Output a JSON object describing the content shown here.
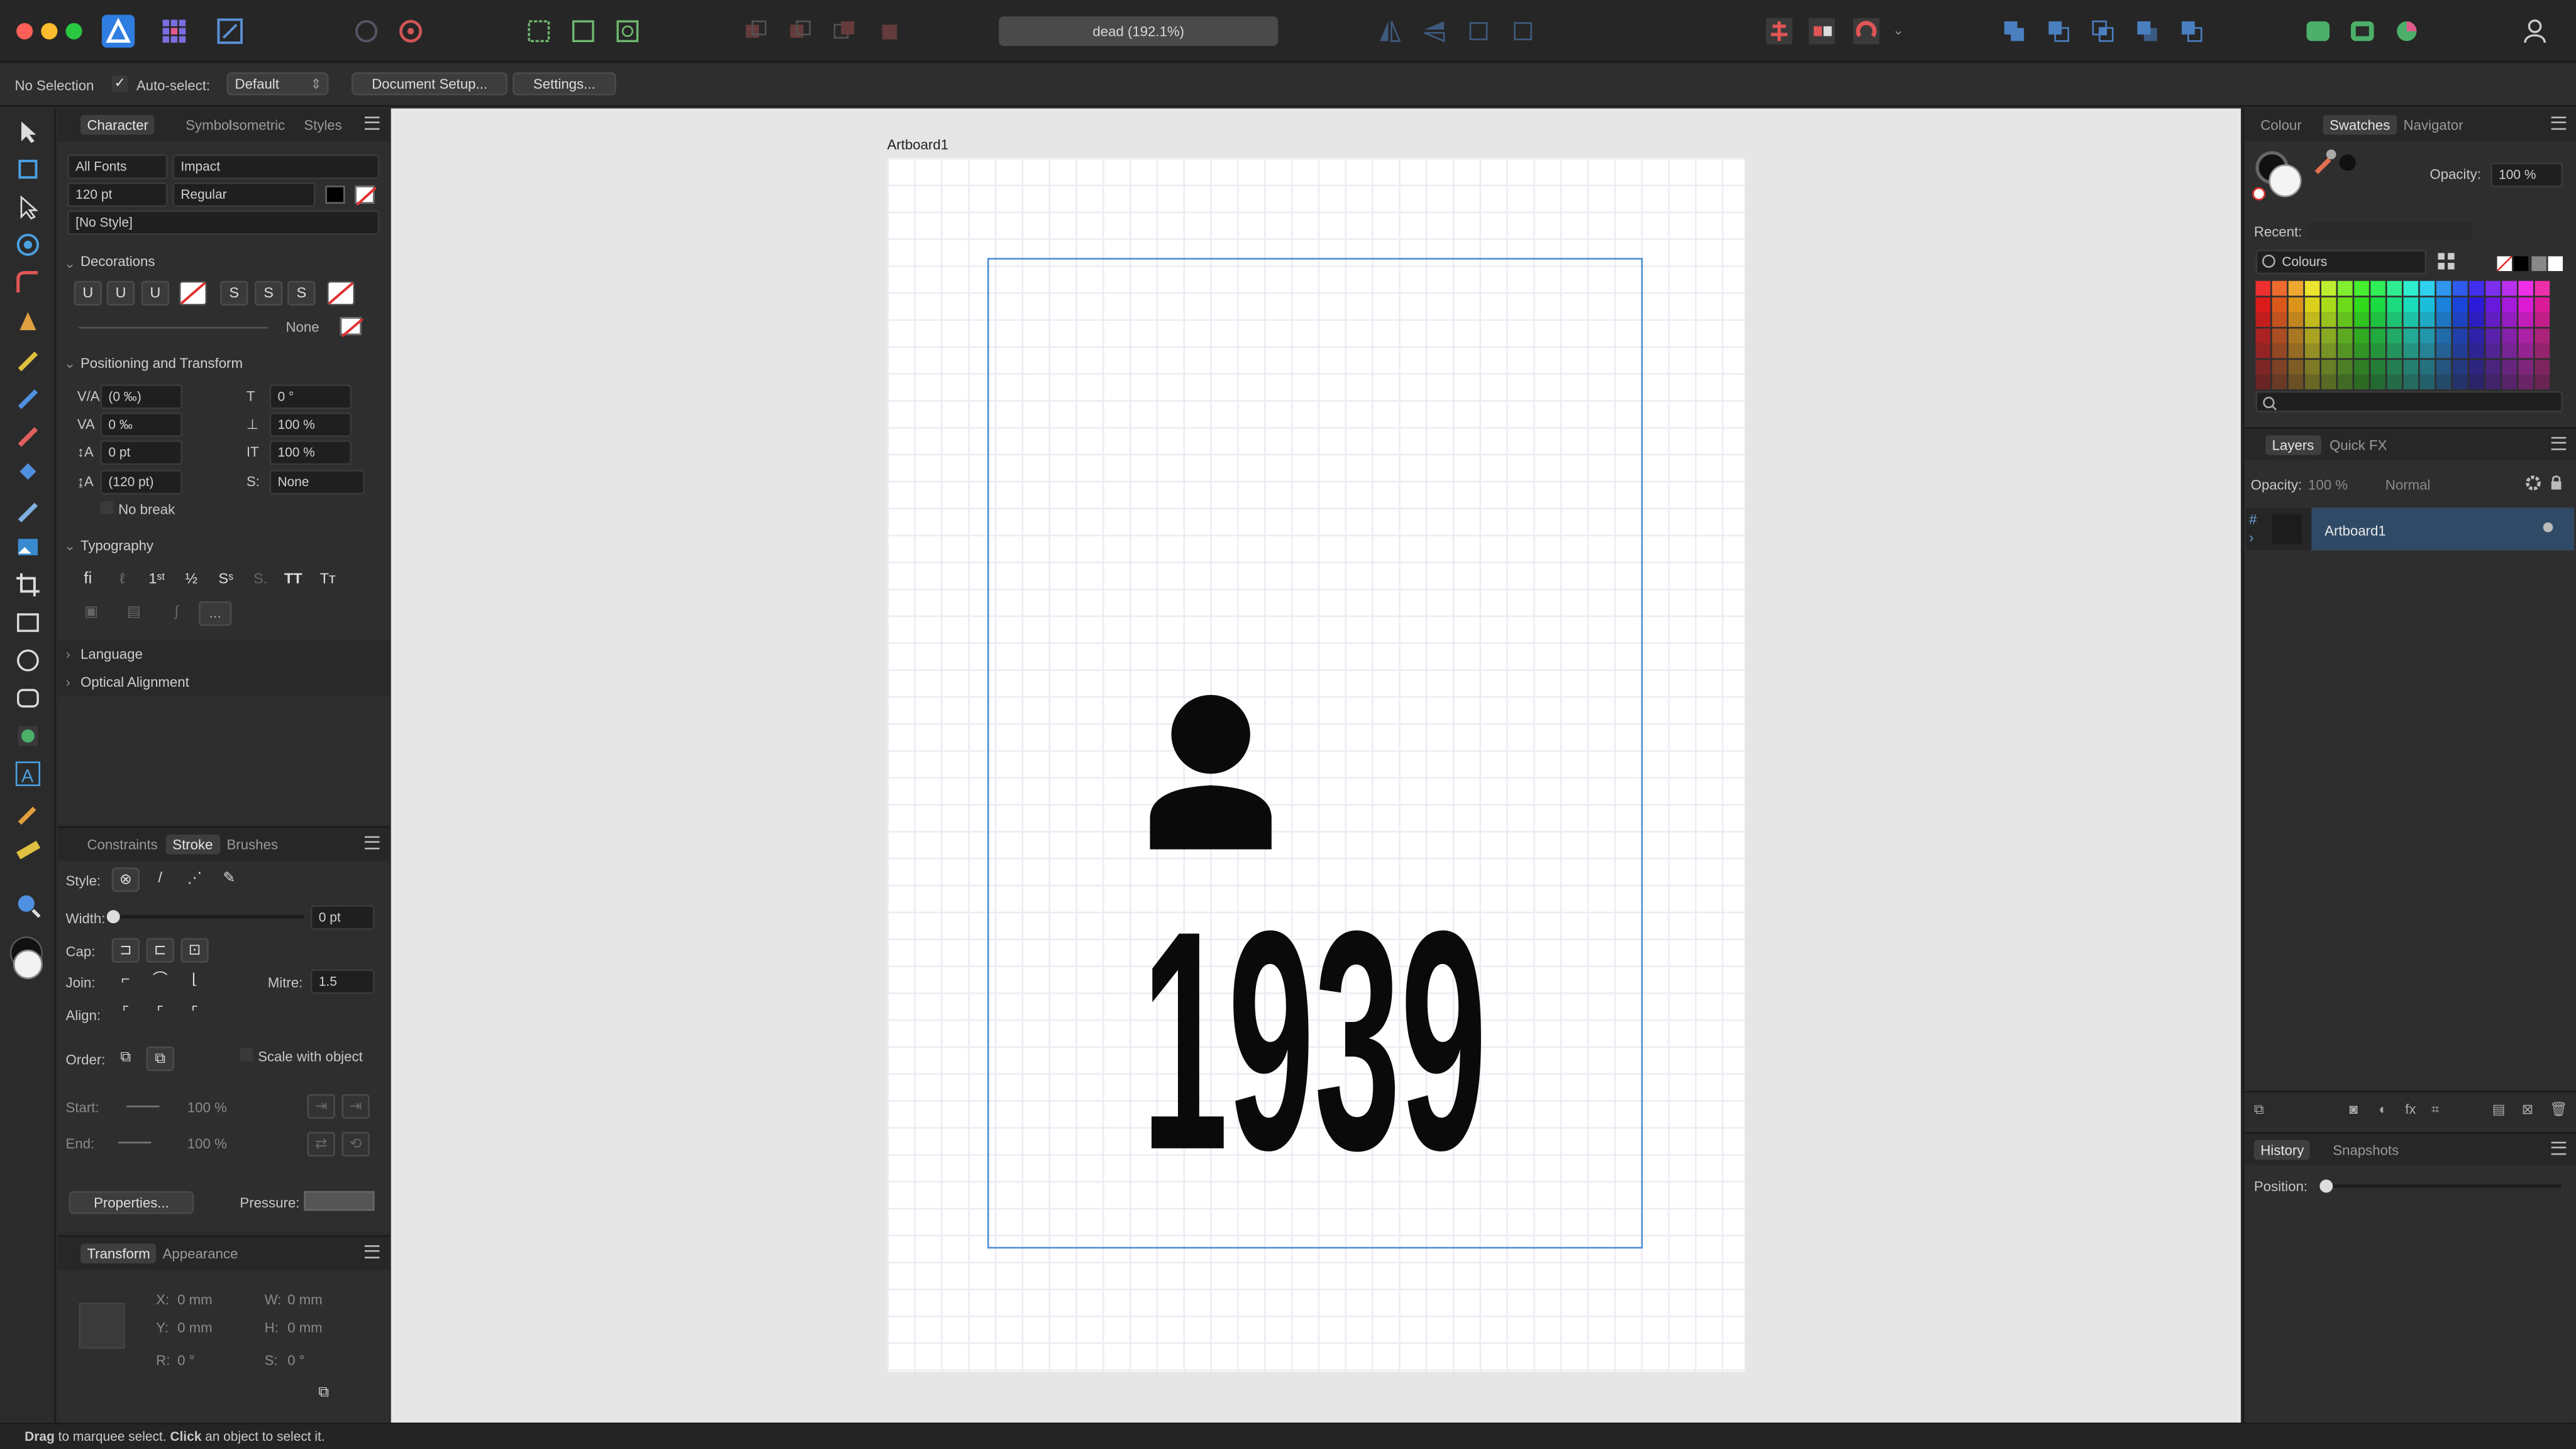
{
  "app": {
    "doc_title": "dead (192.1%)"
  },
  "context_bar": {
    "selection": "No Selection",
    "auto_select_label": "Auto-select:",
    "auto_select_value": "Default",
    "document_setup": "Document Setup...",
    "settings": "Settings..."
  },
  "character_panel": {
    "tabs": [
      "Character",
      "Symbols",
      "Isometric",
      "Styles"
    ],
    "font_collection": "All Fonts",
    "font_family": "Impact",
    "font_size": "120 pt",
    "font_style": "Regular",
    "paragraph_style": "[No Style]",
    "decorations_header": "Decorations",
    "decorations_none": "None",
    "positioning_header": "Positioning and Transform",
    "kerning": "(0 ‰)",
    "tracking": "0 ‰",
    "baseline": "0 pt",
    "leading": "(120 pt)",
    "shear": "0 °",
    "vertical_scale": "100 %",
    "horizontal_scale": "100 %",
    "caps": "None",
    "no_break": "No break",
    "typography_header": "Typography",
    "typo_ellipsis": "...",
    "language_header": "Language",
    "optical_header": "Optical Alignment"
  },
  "stroke_panel": {
    "tabs": [
      "Constraints",
      "Stroke",
      "Brushes"
    ],
    "style_label": "Style:",
    "width_label": "Width:",
    "width_value": "0 pt",
    "cap_label": "Cap:",
    "join_label": "Join:",
    "mitre_label": "Mitre:",
    "mitre_value": "1.5",
    "align_label": "Align:",
    "order_label": "Order:",
    "scale_with_object": "Scale with object",
    "start_label": "Start:",
    "start_pct": "100 %",
    "end_label": "End:",
    "end_pct": "100 %",
    "properties_button": "Properties...",
    "pressure_label": "Pressure:"
  },
  "transform_panel": {
    "tabs": [
      "Transform",
      "Appearance"
    ],
    "x_label": "X:",
    "x_value": "0 mm",
    "y_label": "Y:",
    "y_value": "0 mm",
    "w_label": "W:",
    "w_value": "0 mm",
    "h_label": "H:",
    "h_value": "0 mm",
    "r_label": "R:",
    "r_value": "0 °",
    "s_label": "S:",
    "s_value": "0 °"
  },
  "canvas": {
    "artboard_label": "Artboard1",
    "artwork_text": "1939"
  },
  "swatches_panel": {
    "tabs": [
      "Colour",
      "Swatches",
      "Navigator"
    ],
    "opacity_label": "Opacity:",
    "opacity_value": "100 %",
    "recent_label": "Recent:",
    "palette": "Colours"
  },
  "layers_panel": {
    "tabs": [
      "Layers",
      "Quick FX"
    ],
    "opacity_label": "Opacity:",
    "opacity_value": "100 %",
    "blend_mode": "Normal",
    "layer_name": "Artboard1"
  },
  "history_panel": {
    "tabs": [
      "History",
      "Snapshots"
    ],
    "position_label": "Position:"
  },
  "status": {
    "drag_bold": "Drag",
    "drag_text": " to marquee select. ",
    "click_bold": "Click",
    "click_text": " an object to select it."
  },
  "colors": {
    "accent": "#4d8fd6",
    "background": "#2b2b2b",
    "canvas": "#e6e6e6",
    "layer_selected": "#2f4a66"
  }
}
